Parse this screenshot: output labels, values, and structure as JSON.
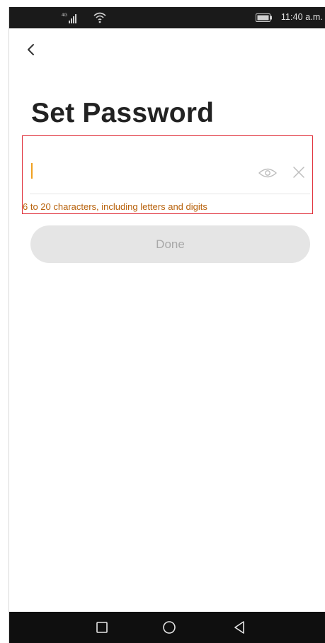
{
  "status_bar": {
    "signal_icon": "signal-icon",
    "wifi_icon": "wifi-icon",
    "battery_icon": "battery-icon",
    "time": "11:40 a.m."
  },
  "header": {
    "back_icon": "chevron-left-icon"
  },
  "page": {
    "title": "Set Password"
  },
  "password_field": {
    "value": "",
    "placeholder": "",
    "hint": "6 to 20 characters, including letters and digits",
    "show_password_icon": "eye-icon",
    "clear_icon": "close-icon"
  },
  "done_button": {
    "label": "Done",
    "enabled": false
  },
  "nav_bar": {
    "recent_icon": "square-icon",
    "home_icon": "circle-icon",
    "back_icon": "triangle-back-icon"
  },
  "colors": {
    "status_bar_bg": "#1a1a1a",
    "nav_bar_bg": "#0f0f0f",
    "title_text": "#222222",
    "hint_text": "#b8620c",
    "caret": "#f0a020",
    "highlight_border": "#e0303a",
    "button_disabled_bg": "#e5e5e5",
    "button_disabled_text": "#a8a8a8"
  }
}
